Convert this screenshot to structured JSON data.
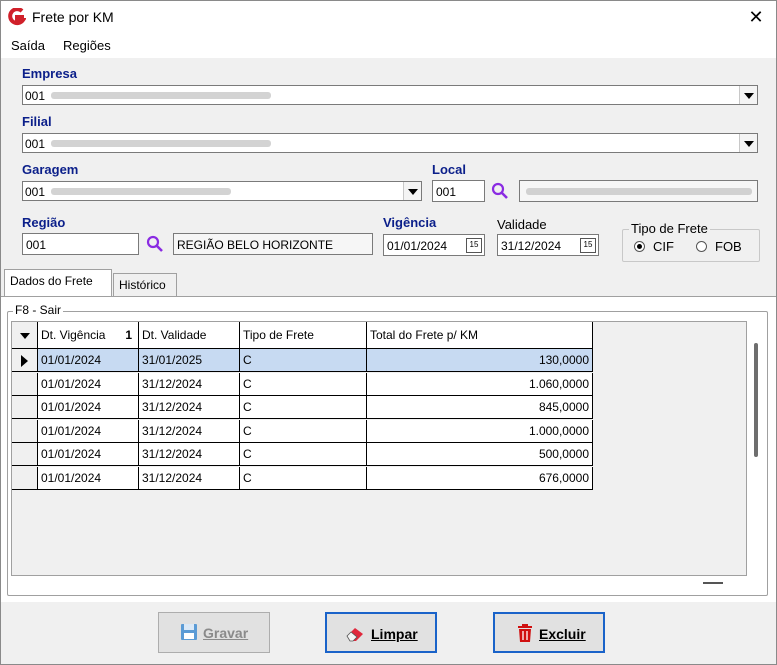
{
  "window": {
    "title": "Frete por KM",
    "close_glyph": "✕"
  },
  "menu": {
    "items": [
      "Saída",
      "Regiões"
    ]
  },
  "form": {
    "empresa": {
      "label": "Empresa",
      "value": "001"
    },
    "filial": {
      "label": "Filial",
      "value": "001"
    },
    "garagem": {
      "label": "Garagem",
      "value": "001"
    },
    "local": {
      "label": "Local",
      "code": "001"
    },
    "regiao": {
      "label": "Região",
      "code": "001",
      "name": "REGIÃO BELO HORIZONTE"
    },
    "vigencia": {
      "label": "Vigência",
      "value": "01/01/2024"
    },
    "validade": {
      "label": "Validade",
      "value": "31/12/2024"
    },
    "tipo_frete": {
      "label": "Tipo de Frete",
      "options": [
        "CIF",
        "FOB"
      ],
      "selected": "CIF"
    }
  },
  "tabs": [
    {
      "label": "Dados do Frete",
      "active": true
    },
    {
      "label": "Histórico",
      "active": false
    }
  ],
  "section_title": "F8 - Sair",
  "table": {
    "columns": [
      "Dt. Vigência",
      "Dt. Validade",
      "Tipo de Frete",
      "Total do Frete p/ KM"
    ],
    "sort_indicator": "1",
    "rows": [
      [
        "01/01/2024",
        "31/01/2025",
        "C",
        "130,0000"
      ],
      [
        "01/01/2024",
        "31/12/2024",
        "C",
        "1.060,0000"
      ],
      [
        "01/01/2024",
        "31/12/2024",
        "C",
        "845,0000"
      ],
      [
        "01/01/2024",
        "31/12/2024",
        "C",
        "1.000,0000"
      ],
      [
        "01/01/2024",
        "31/12/2024",
        "C",
        "500,0000"
      ],
      [
        "01/01/2024",
        "31/12/2024",
        "C",
        "676,0000"
      ]
    ]
  },
  "buttons": {
    "gravar": "Gravar",
    "limpar": "Limpar",
    "excluir": "Excluir"
  },
  "colors": {
    "label_blue": "#0b1f8a",
    "selection": "#c7daf2",
    "accent_purple": "#8a2be2",
    "delete_red": "#d01010"
  }
}
